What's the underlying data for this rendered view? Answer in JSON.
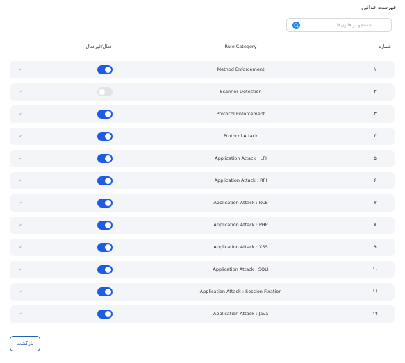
{
  "title": "فهرست قوانین",
  "search": {
    "placeholder": "جستجو در قانون‌ها"
  },
  "columns": {
    "number": "شماره",
    "category": "Rule Category",
    "status": "فعال/غیرفعال"
  },
  "rows": [
    {
      "number": "۱",
      "category": "Method Enforcement",
      "enabled": true
    },
    {
      "number": "۲",
      "category": "Scanner Detection",
      "enabled": false
    },
    {
      "number": "۳",
      "category": "Protocol Enforcement",
      "enabled": true
    },
    {
      "number": "۴",
      "category": "Protocol Attack",
      "enabled": true
    },
    {
      "number": "۵",
      "category": "Application Attack : LFI",
      "enabled": true
    },
    {
      "number": "۶",
      "category": "Application Attack : RFI",
      "enabled": true
    },
    {
      "number": "۷",
      "category": "Application Attack : RCE",
      "enabled": true
    },
    {
      "number": "۸",
      "category": "Application Attack : PHP",
      "enabled": true
    },
    {
      "number": "۹",
      "category": "Application Attack : XSS",
      "enabled": true
    },
    {
      "number": "۱۰",
      "category": "Application Attack : SQLI",
      "enabled": true
    },
    {
      "number": "۱۱",
      "category": "Application Attack : Session Fixation",
      "enabled": true
    },
    {
      "number": "۱۲",
      "category": "Application Attack : Java",
      "enabled": true
    }
  ],
  "back_label": "بازگشت",
  "colors": {
    "accent": "#1e5ce6",
    "search_icon": "#1e88e5",
    "row_bg": "#f4f5f8",
    "button_border": "#1e63b5"
  }
}
